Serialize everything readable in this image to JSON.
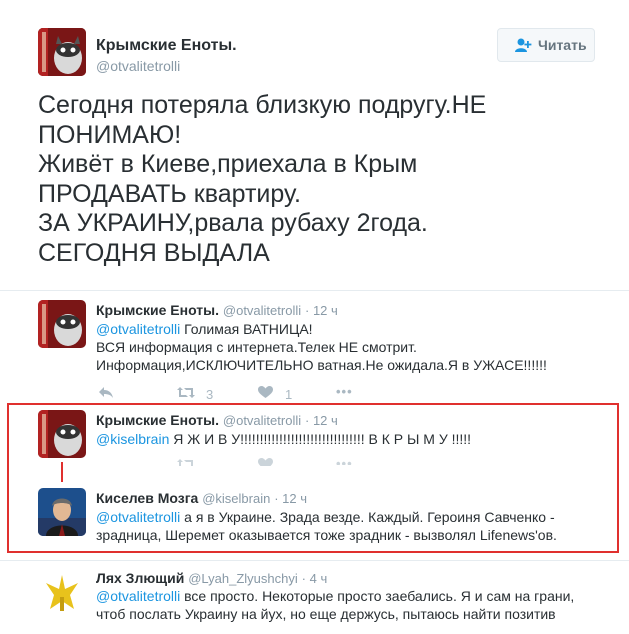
{
  "colors": {
    "accent": "#1b95e0",
    "highlight_border": "#e0302e",
    "muted": "#8899a6"
  },
  "header": {
    "author_name": "Крымские Еноты.",
    "author_handle": "@otvalitetrolli",
    "follow_label": "Читать",
    "follow_icon": "add-user-icon"
  },
  "main_tweet": {
    "lines": [
      "Сегодня потеряла близкую подругу.НЕ",
      "ПОНИМАЮ!",
      "Живёт в Киеве,приехала в Крым",
      "ПРОДАВАТЬ квартиру.",
      "ЗА УКРАИНУ,рвала рубаху 2года.",
      "СЕГОДНЯ ВЫДАЛА"
    ]
  },
  "replies": [
    {
      "name": "Крымские Еноты.",
      "handle": "@otvalitetrolli",
      "time": "· 12 ч",
      "mention": "@otvalitetrolli",
      "line1_rest": " Голимая ВАТНИЦА!",
      "line2": "ВСЯ информация с интернета.Телек НЕ смотрит.",
      "line3": "Информация,ИСКЛЮЧИТЕЛЬНО ватная.Не ожидала.Я в УЖАСЕ!!!!!!",
      "retweets": "3",
      "likes": "1"
    },
    {
      "name": "Крымские Еноты.",
      "handle": "@otvalitetrolli",
      "time": "· 12 ч",
      "mention": "@kiselbrain",
      "line1_rest": " Я  Ж И В У!!!!!!!!!!!!!!!!!!!!!!!!!!!!!!!! В К Р Ы М У !!!!!"
    },
    {
      "name": "Киселев Мозга",
      "handle": "@kiselbrain",
      "time": "· 12 ч",
      "mention": "@otvalitetrolli",
      "line1_rest": " а я в Украине. Зрада везде. Каждый. Героиня Савченко -",
      "line2": "зрадница, Шеремет оказывается тоже зрадник - вызволял Lifenews'ов."
    },
    {
      "name": "Лях Злющий",
      "handle": "@Lyah_Zlyushchyi",
      "time": "· 4 ч",
      "mention": "@otvalitetrolli",
      "line1_rest": " все просто. Некоторые просто заебались. Я и сам на грани,",
      "line2": "чтоб послать Украину на йух, но еще держусь, пытаюсь найти позитив"
    }
  ]
}
